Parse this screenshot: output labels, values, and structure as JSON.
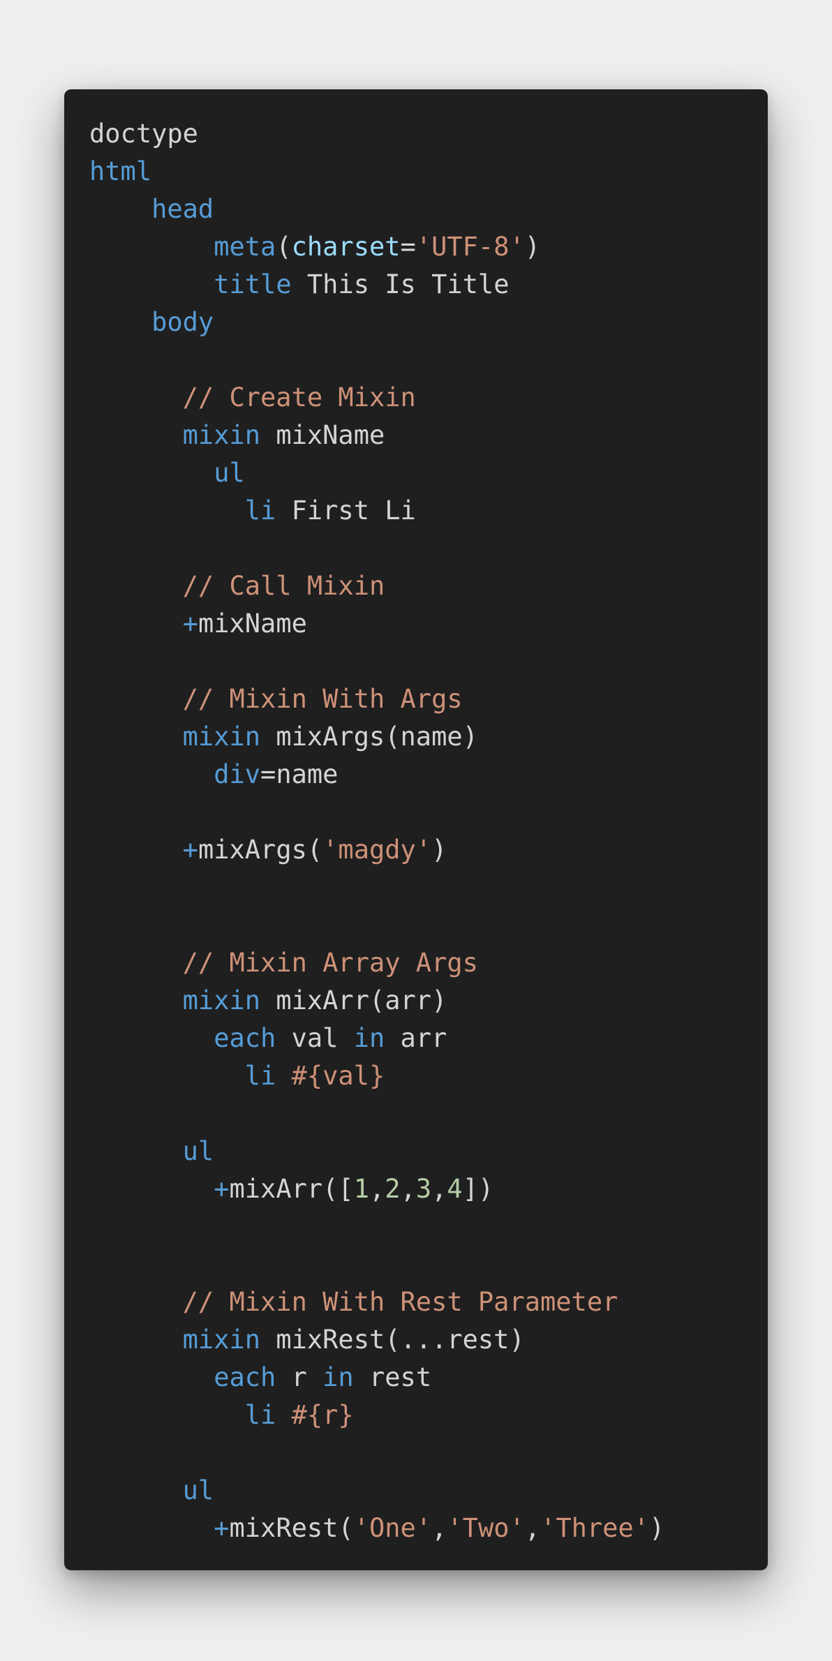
{
  "editor": {
    "lines": [
      [
        {
          "t": "doctype",
          "c": "plain"
        }
      ],
      [
        {
          "t": "html",
          "c": "kw"
        }
      ],
      [
        {
          "t": "    ",
          "c": "plain"
        },
        {
          "t": "head",
          "c": "kw"
        }
      ],
      [
        {
          "t": "        ",
          "c": "plain"
        },
        {
          "t": "meta",
          "c": "kw"
        },
        {
          "t": "(",
          "c": "plain"
        },
        {
          "t": "charset",
          "c": "attr"
        },
        {
          "t": "=",
          "c": "plain"
        },
        {
          "t": "'UTF-8'",
          "c": "str"
        },
        {
          "t": ")",
          "c": "plain"
        }
      ],
      [
        {
          "t": "        ",
          "c": "plain"
        },
        {
          "t": "title",
          "c": "kw"
        },
        {
          "t": " This Is Title",
          "c": "plain"
        }
      ],
      [
        {
          "t": "    ",
          "c": "plain"
        },
        {
          "t": "body",
          "c": "kw"
        }
      ],
      [],
      [
        {
          "t": "      ",
          "c": "plain"
        },
        {
          "t": "// Create Mixin",
          "c": "cmt"
        }
      ],
      [
        {
          "t": "      ",
          "c": "plain"
        },
        {
          "t": "mixin",
          "c": "kw"
        },
        {
          "t": " mixName",
          "c": "plain"
        }
      ],
      [
        {
          "t": "        ",
          "c": "plain"
        },
        {
          "t": "ul",
          "c": "kw"
        }
      ],
      [
        {
          "t": "          ",
          "c": "plain"
        },
        {
          "t": "li",
          "c": "kw"
        },
        {
          "t": " First Li",
          "c": "plain"
        }
      ],
      [],
      [
        {
          "t": "      ",
          "c": "plain"
        },
        {
          "t": "// Call Mixin",
          "c": "cmt"
        }
      ],
      [
        {
          "t": "      ",
          "c": "plain"
        },
        {
          "t": "+",
          "c": "kw"
        },
        {
          "t": "mixName",
          "c": "plain"
        }
      ],
      [],
      [
        {
          "t": "      ",
          "c": "plain"
        },
        {
          "t": "// Mixin With Args",
          "c": "cmt"
        }
      ],
      [
        {
          "t": "      ",
          "c": "plain"
        },
        {
          "t": "mixin",
          "c": "kw"
        },
        {
          "t": " mixArgs(name)",
          "c": "plain"
        }
      ],
      [
        {
          "t": "        ",
          "c": "plain"
        },
        {
          "t": "div",
          "c": "kw"
        },
        {
          "t": "=name",
          "c": "plain"
        }
      ],
      [],
      [
        {
          "t": "      ",
          "c": "plain"
        },
        {
          "t": "+",
          "c": "kw"
        },
        {
          "t": "mixArgs(",
          "c": "plain"
        },
        {
          "t": "'magdy'",
          "c": "str"
        },
        {
          "t": ")",
          "c": "plain"
        }
      ],
      [],
      [],
      [
        {
          "t": "      ",
          "c": "plain"
        },
        {
          "t": "// Mixin Array Args",
          "c": "cmt"
        }
      ],
      [
        {
          "t": "      ",
          "c": "plain"
        },
        {
          "t": "mixin",
          "c": "kw"
        },
        {
          "t": " mixArr(arr)",
          "c": "plain"
        }
      ],
      [
        {
          "t": "        ",
          "c": "plain"
        },
        {
          "t": "each",
          "c": "kw"
        },
        {
          "t": " val ",
          "c": "plain"
        },
        {
          "t": "in",
          "c": "kw"
        },
        {
          "t": " arr",
          "c": "plain"
        }
      ],
      [
        {
          "t": "          ",
          "c": "plain"
        },
        {
          "t": "li",
          "c": "kw"
        },
        {
          "t": " ",
          "c": "plain"
        },
        {
          "t": "#{val}",
          "c": "str"
        }
      ],
      [],
      [
        {
          "t": "      ",
          "c": "plain"
        },
        {
          "t": "ul",
          "c": "kw"
        }
      ],
      [
        {
          "t": "        ",
          "c": "plain"
        },
        {
          "t": "+",
          "c": "kw"
        },
        {
          "t": "mixArr([",
          "c": "plain"
        },
        {
          "t": "1",
          "c": "num"
        },
        {
          "t": ",",
          "c": "plain"
        },
        {
          "t": "2",
          "c": "num"
        },
        {
          "t": ",",
          "c": "plain"
        },
        {
          "t": "3",
          "c": "num"
        },
        {
          "t": ",",
          "c": "plain"
        },
        {
          "t": "4",
          "c": "num"
        },
        {
          "t": "])",
          "c": "plain"
        }
      ],
      [],
      [],
      [
        {
          "t": "      ",
          "c": "plain"
        },
        {
          "t": "// Mixin With Rest Parameter",
          "c": "cmt"
        }
      ],
      [
        {
          "t": "      ",
          "c": "plain"
        },
        {
          "t": "mixin",
          "c": "kw"
        },
        {
          "t": " mixRest(...rest)",
          "c": "plain"
        }
      ],
      [
        {
          "t": "        ",
          "c": "plain"
        },
        {
          "t": "each",
          "c": "kw"
        },
        {
          "t": " r ",
          "c": "plain"
        },
        {
          "t": "in",
          "c": "kw"
        },
        {
          "t": " rest",
          "c": "plain"
        }
      ],
      [
        {
          "t": "          ",
          "c": "plain"
        },
        {
          "t": "li",
          "c": "kw"
        },
        {
          "t": " ",
          "c": "plain"
        },
        {
          "t": "#{r}",
          "c": "str"
        }
      ],
      [],
      [
        {
          "t": "      ",
          "c": "plain"
        },
        {
          "t": "ul",
          "c": "kw"
        }
      ],
      [
        {
          "t": "        ",
          "c": "plain"
        },
        {
          "t": "+",
          "c": "kw"
        },
        {
          "t": "mixRest(",
          "c": "plain"
        },
        {
          "t": "'One'",
          "c": "str"
        },
        {
          "t": ",",
          "c": "plain"
        },
        {
          "t": "'Two'",
          "c": "str"
        },
        {
          "t": ",",
          "c": "plain"
        },
        {
          "t": "'Three'",
          "c": "str"
        },
        {
          "t": ")",
          "c": "plain"
        }
      ]
    ]
  }
}
